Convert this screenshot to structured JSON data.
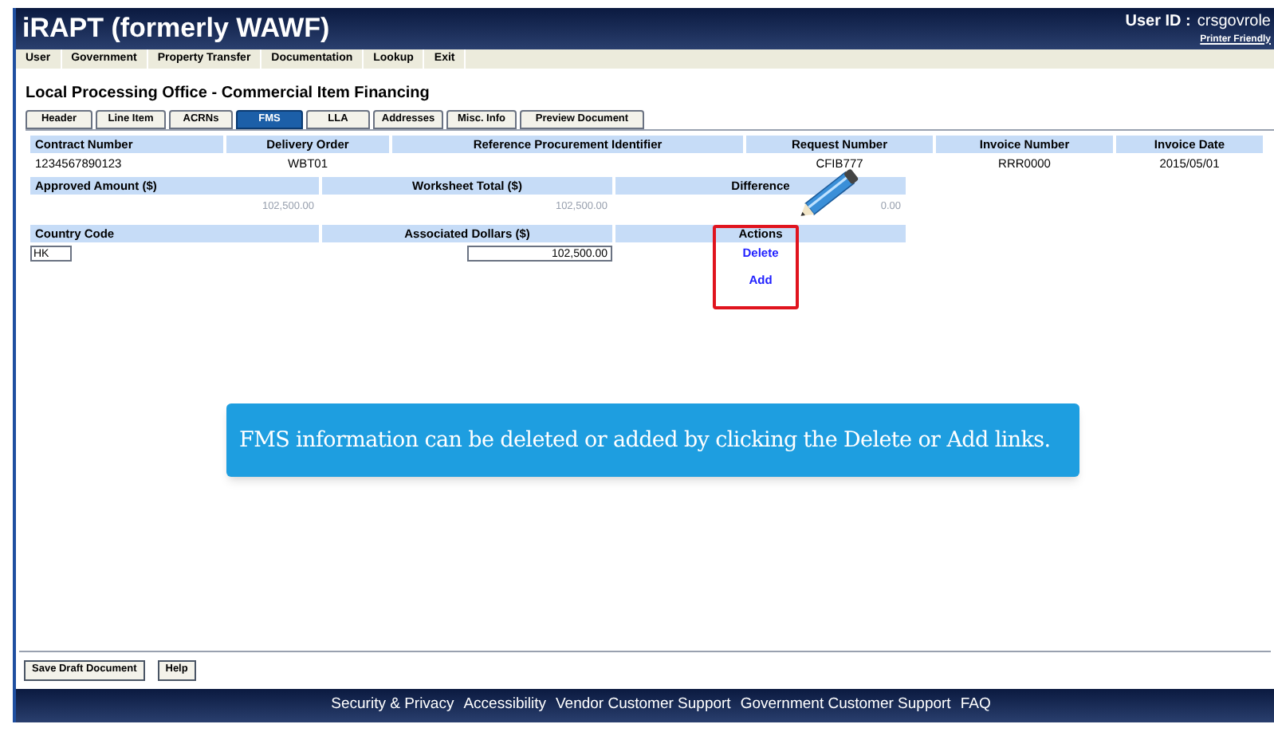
{
  "header": {
    "title": "iRAPT (formerly WAWF)",
    "user_label": "User ID :",
    "user_id": "crsgovrole",
    "printer_link": "Printer Friendly"
  },
  "menu": [
    "User",
    "Government",
    "Property Transfer",
    "Documentation",
    "Lookup",
    "Exit"
  ],
  "page_title": "Local Processing Office - Commercial Item Financing",
  "tabs": [
    {
      "label": "Header",
      "selected": false
    },
    {
      "label": "Line Item",
      "selected": false
    },
    {
      "label": "ACRNs",
      "selected": false
    },
    {
      "label": "FMS",
      "selected": true
    },
    {
      "label": "LLA",
      "selected": false
    },
    {
      "label": "Addresses",
      "selected": false
    },
    {
      "label": "Misc. Info",
      "selected": false
    },
    {
      "label": "Preview Document",
      "selected": false
    }
  ],
  "summary": {
    "columns": [
      {
        "header": "Contract Number",
        "value": "1234567890123"
      },
      {
        "header": "Delivery Order",
        "value": "WBT01"
      },
      {
        "header": "Reference Procurement Identifier"
      },
      {
        "header": "Request Number",
        "value": "CFIB777"
      },
      {
        "header": "Invoice Number",
        "value": "RRR0000"
      },
      {
        "header": "Invoice Date",
        "value": "2015/05/01"
      }
    ]
  },
  "totals": {
    "columns": [
      "Approved Amount ($)",
      "Worksheet Total ($)",
      "Difference"
    ],
    "values": [
      "102,500.00",
      "102,500.00",
      "0.00"
    ]
  },
  "fms": {
    "columns": [
      "Country Code",
      "Associated Dollars ($)",
      "Actions"
    ],
    "country_code": "HK",
    "associated_dollars": "102,500.00",
    "actions": [
      "Delete",
      "Add"
    ]
  },
  "callout": "FMS information can be deleted or added by clicking the Delete or Add links.",
  "buttons": [
    "Save Draft Document",
    "Help"
  ],
  "footer_links": [
    "Security & Privacy",
    "Accessibility",
    "Vendor Customer Support",
    "Government Customer Support",
    "FAQ"
  ]
}
